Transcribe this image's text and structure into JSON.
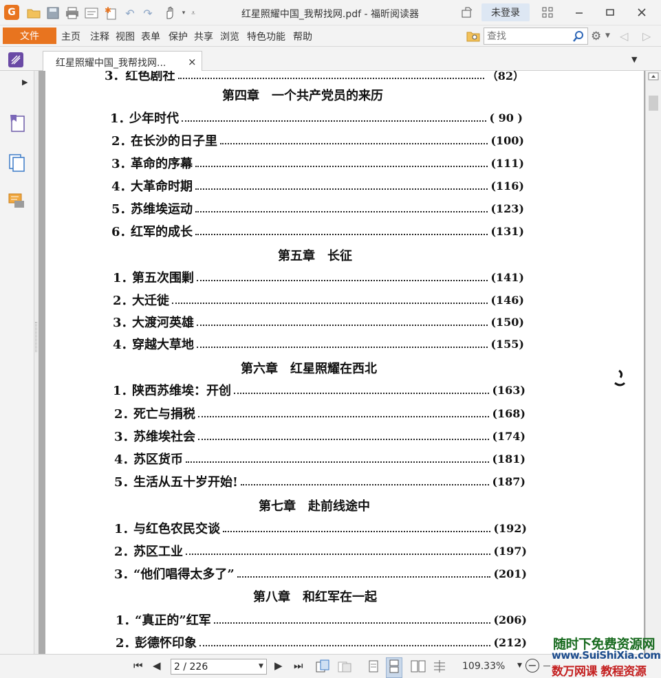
{
  "titlebar": {
    "title": "红星照耀中国_我帮找网.pdf - 福昕阅读器",
    "login": "未登录",
    "app_icon": "G"
  },
  "menubar": {
    "file": "文件",
    "items": [
      "主页",
      "注释",
      "视图",
      "表单",
      "保护",
      "共享",
      "浏览",
      "特色功能",
      "帮助"
    ],
    "search_placeholder": "查找"
  },
  "tab": {
    "label": "红星照耀中国_我帮找网...",
    "close": "×"
  },
  "toc": {
    "partial_top": "3．红色剧社",
    "partial_top_page": "（82）",
    "chapters": [
      {
        "title": "第四章　一个共产党员的来历",
        "entries": [
          {
            "num": "1．",
            "title": "少年时代",
            "page": "( 90 )"
          },
          {
            "num": "2．",
            "title": "在长沙的日子里",
            "page": "(100)"
          },
          {
            "num": "3．",
            "title": "革命的序幕",
            "page": "(111)"
          },
          {
            "num": "4．",
            "title": "大革命时期",
            "page": "(116)"
          },
          {
            "num": "5．",
            "title": "苏维埃运动",
            "page": "(123)"
          },
          {
            "num": "6．",
            "title": "红军的成长",
            "page": "(131)"
          }
        ]
      },
      {
        "title": "第五章　长征",
        "entries": [
          {
            "num": "1．",
            "title": "第五次围剿",
            "page": "(141)"
          },
          {
            "num": "2．",
            "title": "大迁徙",
            "page": "(146)"
          },
          {
            "num": "3．",
            "title": "大渡河英雄",
            "page": "(150)"
          },
          {
            "num": "4．",
            "title": "穿越大草地",
            "page": "(155)"
          }
        ]
      },
      {
        "title": "第六章　红星照耀在西北",
        "entries": [
          {
            "num": "1．",
            "title": "陕西苏维埃：开创",
            "page": "(163)"
          },
          {
            "num": "2．",
            "title": "死亡与捐税",
            "page": "(168)"
          },
          {
            "num": "3．",
            "title": "苏维埃社会",
            "page": "(174)"
          },
          {
            "num": "4．",
            "title": "苏区货币",
            "page": "(181)"
          },
          {
            "num": "5．",
            "title": "生活从五十岁开始!",
            "page": "(187)"
          }
        ]
      },
      {
        "title": "第七章　赴前线途中",
        "entries": [
          {
            "num": "1．",
            "title": "与红色农民交谈",
            "page": "(192)"
          },
          {
            "num": "2．",
            "title": "苏区工业",
            "page": "(197)"
          },
          {
            "num": "3．",
            "title": "“他们唱得太多了”",
            "page": "(201)"
          }
        ]
      },
      {
        "title": "第八章　和红军在一起",
        "entries": [
          {
            "num": "1．",
            "title": "“真正的”红军",
            "page": "(206)"
          },
          {
            "num": "2．",
            "title": "彭德怀印象",
            "page": "(212)"
          }
        ]
      }
    ]
  },
  "statusbar": {
    "page_value": "2 / 226",
    "zoom": "109.33%"
  },
  "watermark": {
    "line1": "随时下免费资源网",
    "line2": "www.SuiShiXia.com",
    "line3": "数万网课 教程资源"
  },
  "colors": {
    "accent": "#e8741f",
    "login_bg": "#dde7f3",
    "page_bg": "#ffffff",
    "canvas_bg": "#ababab"
  },
  "icons": {
    "quick_access": [
      "open-folder-icon",
      "save-icon",
      "print-icon",
      "properties-icon",
      "new-icon",
      "undo-icon",
      "redo-icon",
      "hand-tool-icon",
      "customize-icon"
    ],
    "sidebar": [
      "bookmark-icon",
      "pages-icon",
      "comments-icon"
    ],
    "window": [
      "share-icon",
      "restore-layout-icon",
      "minimize-icon",
      "maximize-icon",
      "close-icon"
    ],
    "statusbar": [
      "first-page-icon",
      "prev-page-icon",
      "next-page-icon",
      "last-page-icon",
      "insert-page-icon",
      "replace-page-icon",
      "single-page-icon",
      "continuous-icon",
      "facing-icon",
      "continuous-facing-icon",
      "zoom-out-icon"
    ]
  }
}
